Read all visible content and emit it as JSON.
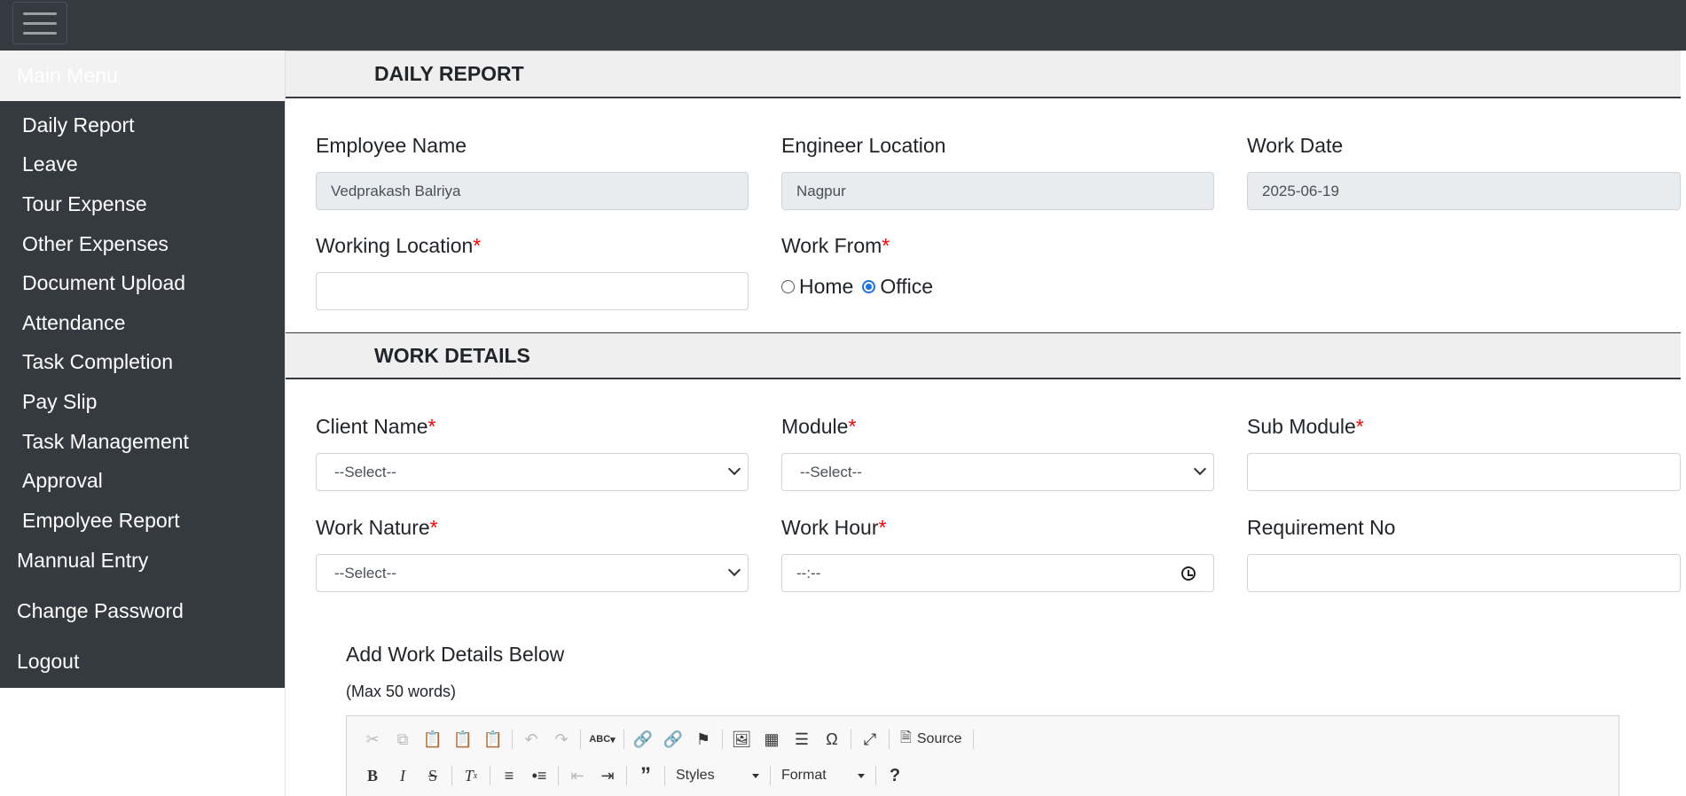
{
  "sidebar": {
    "header": "Main Menu",
    "items": [
      {
        "label": "Daily Report"
      },
      {
        "label": "Leave"
      },
      {
        "label": "Tour Expense"
      },
      {
        "label": "Other Expenses"
      },
      {
        "label": "Document Upload"
      },
      {
        "label": "Attendance"
      },
      {
        "label": "Task Completion"
      },
      {
        "label": "Pay Slip"
      },
      {
        "label": "Task Management"
      },
      {
        "label": "Approval"
      },
      {
        "label": "Empolyee Report"
      }
    ],
    "extra": {
      "manual_entry": "Mannual Entry",
      "change_password": "Change Password",
      "logout": "Logout"
    }
  },
  "daily_report": {
    "title": "DAILY REPORT",
    "employee_name": {
      "label": "Employee Name",
      "value": "Vedprakash Balriya"
    },
    "engineer_location": {
      "label": "Engineer Location",
      "value": "Nagpur"
    },
    "work_date": {
      "label": "Work Date",
      "value": "2025-06-19"
    },
    "working_location": {
      "label": "Working Location",
      "required": "*",
      "value": ""
    },
    "work_from": {
      "label": "Work From",
      "required": "*",
      "options": [
        {
          "label": "Home",
          "checked": false
        },
        {
          "label": "Office",
          "checked": true
        }
      ]
    }
  },
  "work_details": {
    "title": "WORK DETAILS",
    "client_name": {
      "label": "Client Name",
      "required": "*",
      "value": "--Select--"
    },
    "module": {
      "label": "Module",
      "required": "*",
      "value": "--Select--"
    },
    "sub_module": {
      "label": "Sub Module",
      "required": "*",
      "value": ""
    },
    "work_nature": {
      "label": "Work Nature",
      "required": "*",
      "value": "--Select--"
    },
    "work_hour": {
      "label": "Work Hour",
      "required": "*",
      "value": "--:--"
    },
    "requirement_no": {
      "label": "Requirement No",
      "value": ""
    }
  },
  "editor": {
    "title": "Add Work Details Below",
    "note": "(Max 50 words)",
    "source_label": "Source",
    "styles_label": "Styles",
    "format_label": "Format",
    "spell_label": "ABC",
    "help_label": "?"
  }
}
